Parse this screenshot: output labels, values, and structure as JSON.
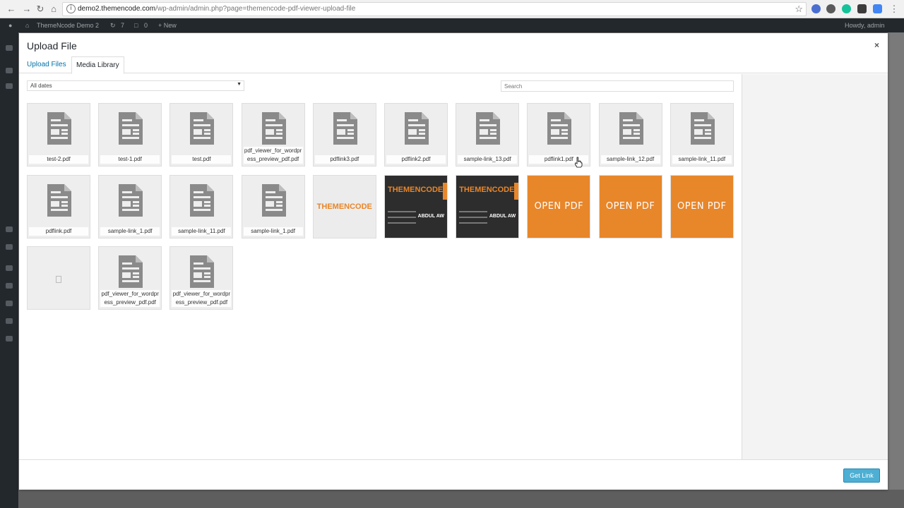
{
  "browser": {
    "url_host": "demo2.themencode.com",
    "url_path": "/wp-admin/admin.php?page=themencode-pdf-viewer-upload-file"
  },
  "adminbar": {
    "site_name": "ThemeNcode Demo 2",
    "updates": "7",
    "comments": "0",
    "new_label": "+ New",
    "greeting": "Howdy, admin"
  },
  "modal": {
    "title": "Upload File",
    "close": "×",
    "tabs": [
      "Upload Files",
      "Media Library"
    ],
    "filter_value": "All dates",
    "search_placeholder": "Search",
    "get_link_label": "Get Link"
  },
  "media_items": [
    {
      "name": "test-2.pdf",
      "kind": "document-icon"
    },
    {
      "name": "test-1.pdf",
      "kind": "document-icon"
    },
    {
      "name": "test.pdf",
      "kind": "document-icon"
    },
    {
      "name": "pdf_viewer_for_wordpress_preview_pdf.pdf",
      "kind": "document-icon"
    },
    {
      "name": "pdflink3.pdf",
      "kind": "document-icon"
    },
    {
      "name": "pdflink2.pdf",
      "kind": "document-icon"
    },
    {
      "name": "sample-link_13.pdf",
      "kind": "document-icon"
    },
    {
      "name": "pdflink1.pdf",
      "kind": "document-icon"
    },
    {
      "name": "sample-link_12.pdf",
      "kind": "document-icon"
    },
    {
      "name": "sample-link_11.pdf",
      "kind": "document-icon"
    },
    {
      "name": "pdflink.pdf",
      "kind": "document-icon"
    },
    {
      "name": "sample-link_1.pdf",
      "kind": "document-icon"
    },
    {
      "name": "sample-link_11.pdf",
      "kind": "document-icon"
    },
    {
      "name": "sample-link_1.pdf",
      "kind": "document-icon"
    },
    {
      "name": "",
      "kind": "themencode-logo",
      "text": "THEMENCODE"
    },
    {
      "name": "",
      "kind": "business-card",
      "text": "THEMENCODE",
      "person": "ABDUL AW"
    },
    {
      "name": "",
      "kind": "business-card",
      "text": "THEMENCODE",
      "person": "ABDUL AW"
    },
    {
      "name": "",
      "kind": "open-pdf-image",
      "text": "OPEN PDF"
    },
    {
      "name": "",
      "kind": "open-pdf-image",
      "text": "OPEN PDF"
    },
    {
      "name": "",
      "kind": "open-pdf-image",
      "text": "OPEN PDF"
    },
    {
      "name": "",
      "kind": "blank-file"
    },
    {
      "name": "pdf_viewer_for_wordpress_preview_pdf.pdf",
      "kind": "document-icon"
    },
    {
      "name": "pdf_viewer_for_wordpress_preview_pdf.pdf",
      "kind": "document-icon"
    }
  ],
  "colors": {
    "accent": "#0073aa",
    "button": "#2ea2cc",
    "orange": "#e8862a",
    "adminbar": "#23282d"
  }
}
